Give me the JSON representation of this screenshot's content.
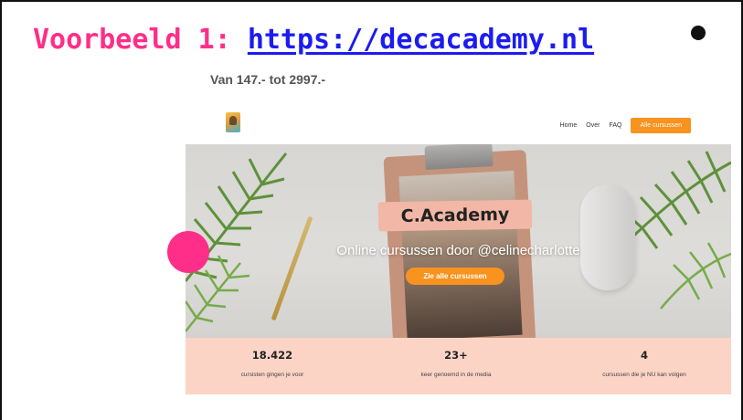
{
  "slide": {
    "title_prefix": "Voorbeeld 1: ",
    "title_link": "https://decacademy.nl",
    "price_range": "Van 147.- tot 2997.-"
  },
  "site": {
    "nav": [
      "Home",
      "Over",
      "FAQ"
    ],
    "nav_cta": "Alle cursussen",
    "hero": {
      "brand": "C.Academy",
      "tagline": "Online cursussen door @celinecharlotte",
      "cta": "Zie alle cursussen"
    },
    "stats": [
      {
        "value": "18.422",
        "label": "cursisten gingen je voor"
      },
      {
        "value": "23+",
        "label": "keer genoemd in de media"
      },
      {
        "value": "4",
        "label": "cursussen die je NU kan volgen"
      }
    ]
  },
  "colors": {
    "title_prefix": "#ff2e88",
    "title_link": "#1c1cf0",
    "accent_orange": "#f7931e",
    "stats_background": "#fcd4c6",
    "pink_dot": "#ff2e88"
  }
}
